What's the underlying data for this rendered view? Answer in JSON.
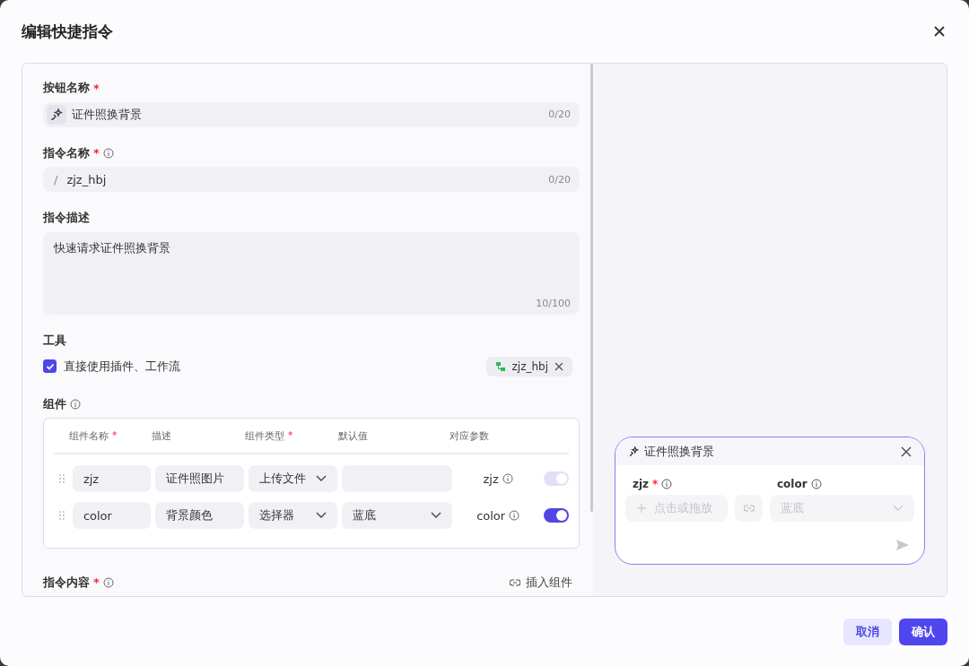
{
  "dialog": {
    "title": "编辑快捷指令"
  },
  "button_name": {
    "label": "按钮名称",
    "required_mark": "*",
    "value": "证件照换背景",
    "counter": "0/20"
  },
  "command_name": {
    "label": "指令名称",
    "required_mark": "*",
    "info": true,
    "prefix": "/",
    "value": "zjz_hbj",
    "counter": "0/20"
  },
  "description": {
    "label": "指令描述",
    "value": "快速请求证件照换背景",
    "counter": "10/100"
  },
  "tools": {
    "label": "工具",
    "checkbox": {
      "label": "直接使用插件、工作流",
      "checked": true
    },
    "tag": {
      "label": "zjz_hbj"
    }
  },
  "components": {
    "label": "组件",
    "info": true,
    "columns": [
      {
        "label": "组件名称",
        "required_mark": "*"
      },
      {
        "label": "描述"
      },
      {
        "label": "组件类型",
        "required_mark": "*"
      },
      {
        "label": "默认值"
      },
      {
        "label": "对应参数"
      }
    ],
    "rows": [
      {
        "name": "zjz",
        "description": "证件照图片",
        "type": "上传文件",
        "default": {
          "kind": "input"
        },
        "param": "zjz",
        "on": true,
        "disabled": true
      },
      {
        "name": "color",
        "description": "背景颜色",
        "type": "选择器",
        "default": {
          "kind": "select",
          "value": "蓝底"
        },
        "param": "color",
        "on": true,
        "disabled": false
      }
    ]
  },
  "content": {
    "label": "指令内容",
    "required_mark": "*",
    "info": true,
    "insert_label": "插入组件"
  },
  "preview": {
    "title": "证件照换背景",
    "fields": [
      {
        "label": "zjz",
        "required_mark": "*",
        "kind": "upload",
        "placeholder": "点击或拖放",
        "disabled": true
      },
      {
        "label": "color",
        "kind": "select",
        "value": "蓝底",
        "disabled": true
      }
    ]
  },
  "buttons": {
    "cancel": "取消",
    "confirm": "确认"
  }
}
